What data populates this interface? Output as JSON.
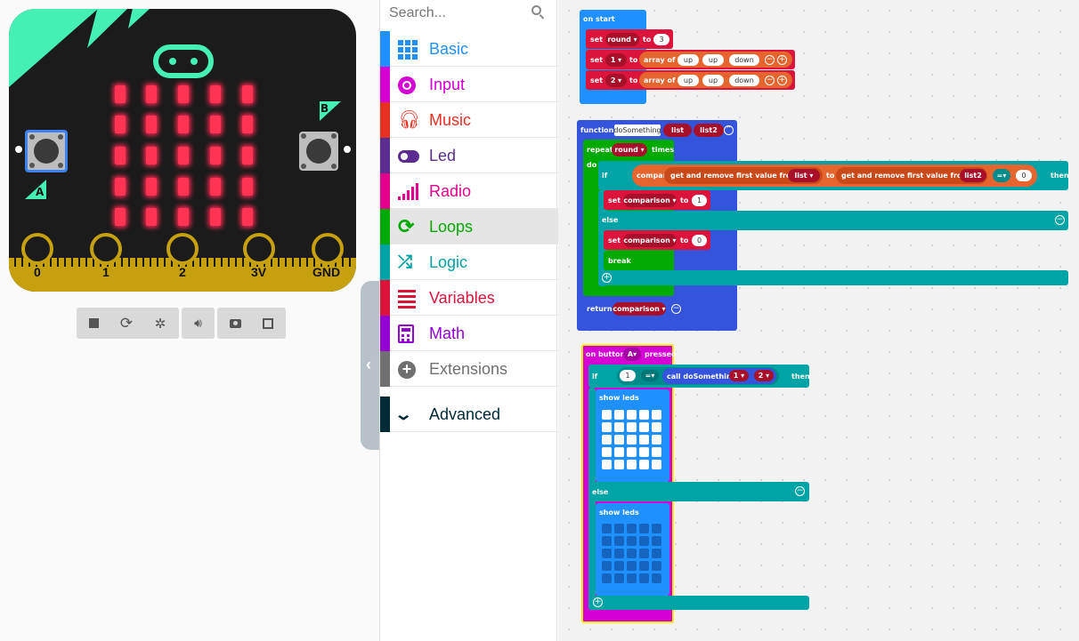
{
  "search": {
    "placeholder": "Search..."
  },
  "simulator": {
    "button_a": "A",
    "button_b": "B",
    "pins": [
      "0",
      "1",
      "2",
      "3V",
      "GND"
    ],
    "toolbar": [
      "stop-icon",
      "restart-icon",
      "debug-icon",
      "sound-icon",
      "screenshot-icon",
      "fullscreen-icon"
    ]
  },
  "toolbox": {
    "categories": [
      {
        "label": "Basic",
        "color": "#1e90ff"
      },
      {
        "label": "Input",
        "color": "#d400d4"
      },
      {
        "label": "Music",
        "color": "#e63022"
      },
      {
        "label": "Led",
        "color": "#5c2d91"
      },
      {
        "label": "Radio",
        "color": "#e3008c"
      },
      {
        "label": "Loops",
        "color": "#00aa00"
      },
      {
        "label": "Logic",
        "color": "#00a4a6"
      },
      {
        "label": "Variables",
        "color": "#dc143c"
      },
      {
        "label": "Math",
        "color": "#9400d3"
      },
      {
        "label": "Extensions",
        "color": "#707070"
      },
      {
        "label": "Advanced",
        "color": "#002b36"
      }
    ],
    "selected": "Loops"
  },
  "blocks": {
    "on_start": {
      "header": "on start",
      "set": "set",
      "to": "to",
      "round": "round",
      "round_value": "3",
      "var1": "1",
      "var2": "2",
      "array_of": "array of",
      "up": "up",
      "down": "down"
    },
    "function": {
      "keyword": "function",
      "name": "doSomething",
      "param1": "list",
      "param2": "list2",
      "repeat": "repeat",
      "round": "round",
      "times": "times",
      "do": "do",
      "if": "if",
      "compare": "compare",
      "get_remove_first": "get and remove first value from",
      "list": "list",
      "to": "to",
      "list2": "list2",
      "eq": "=",
      "zero": "0",
      "then": "then",
      "set": "set",
      "comparison": "comparison",
      "one": "1",
      "else": "else",
      "break": "break",
      "return": "return"
    },
    "on_button": {
      "on_button": "on button",
      "button": "A",
      "pressed": "pressed",
      "if": "if",
      "one": "1",
      "eq": "=",
      "call": "call doSomething",
      "arg1": "1",
      "arg2": "2",
      "then": "then",
      "show_leds": "show leds",
      "else": "else"
    }
  }
}
